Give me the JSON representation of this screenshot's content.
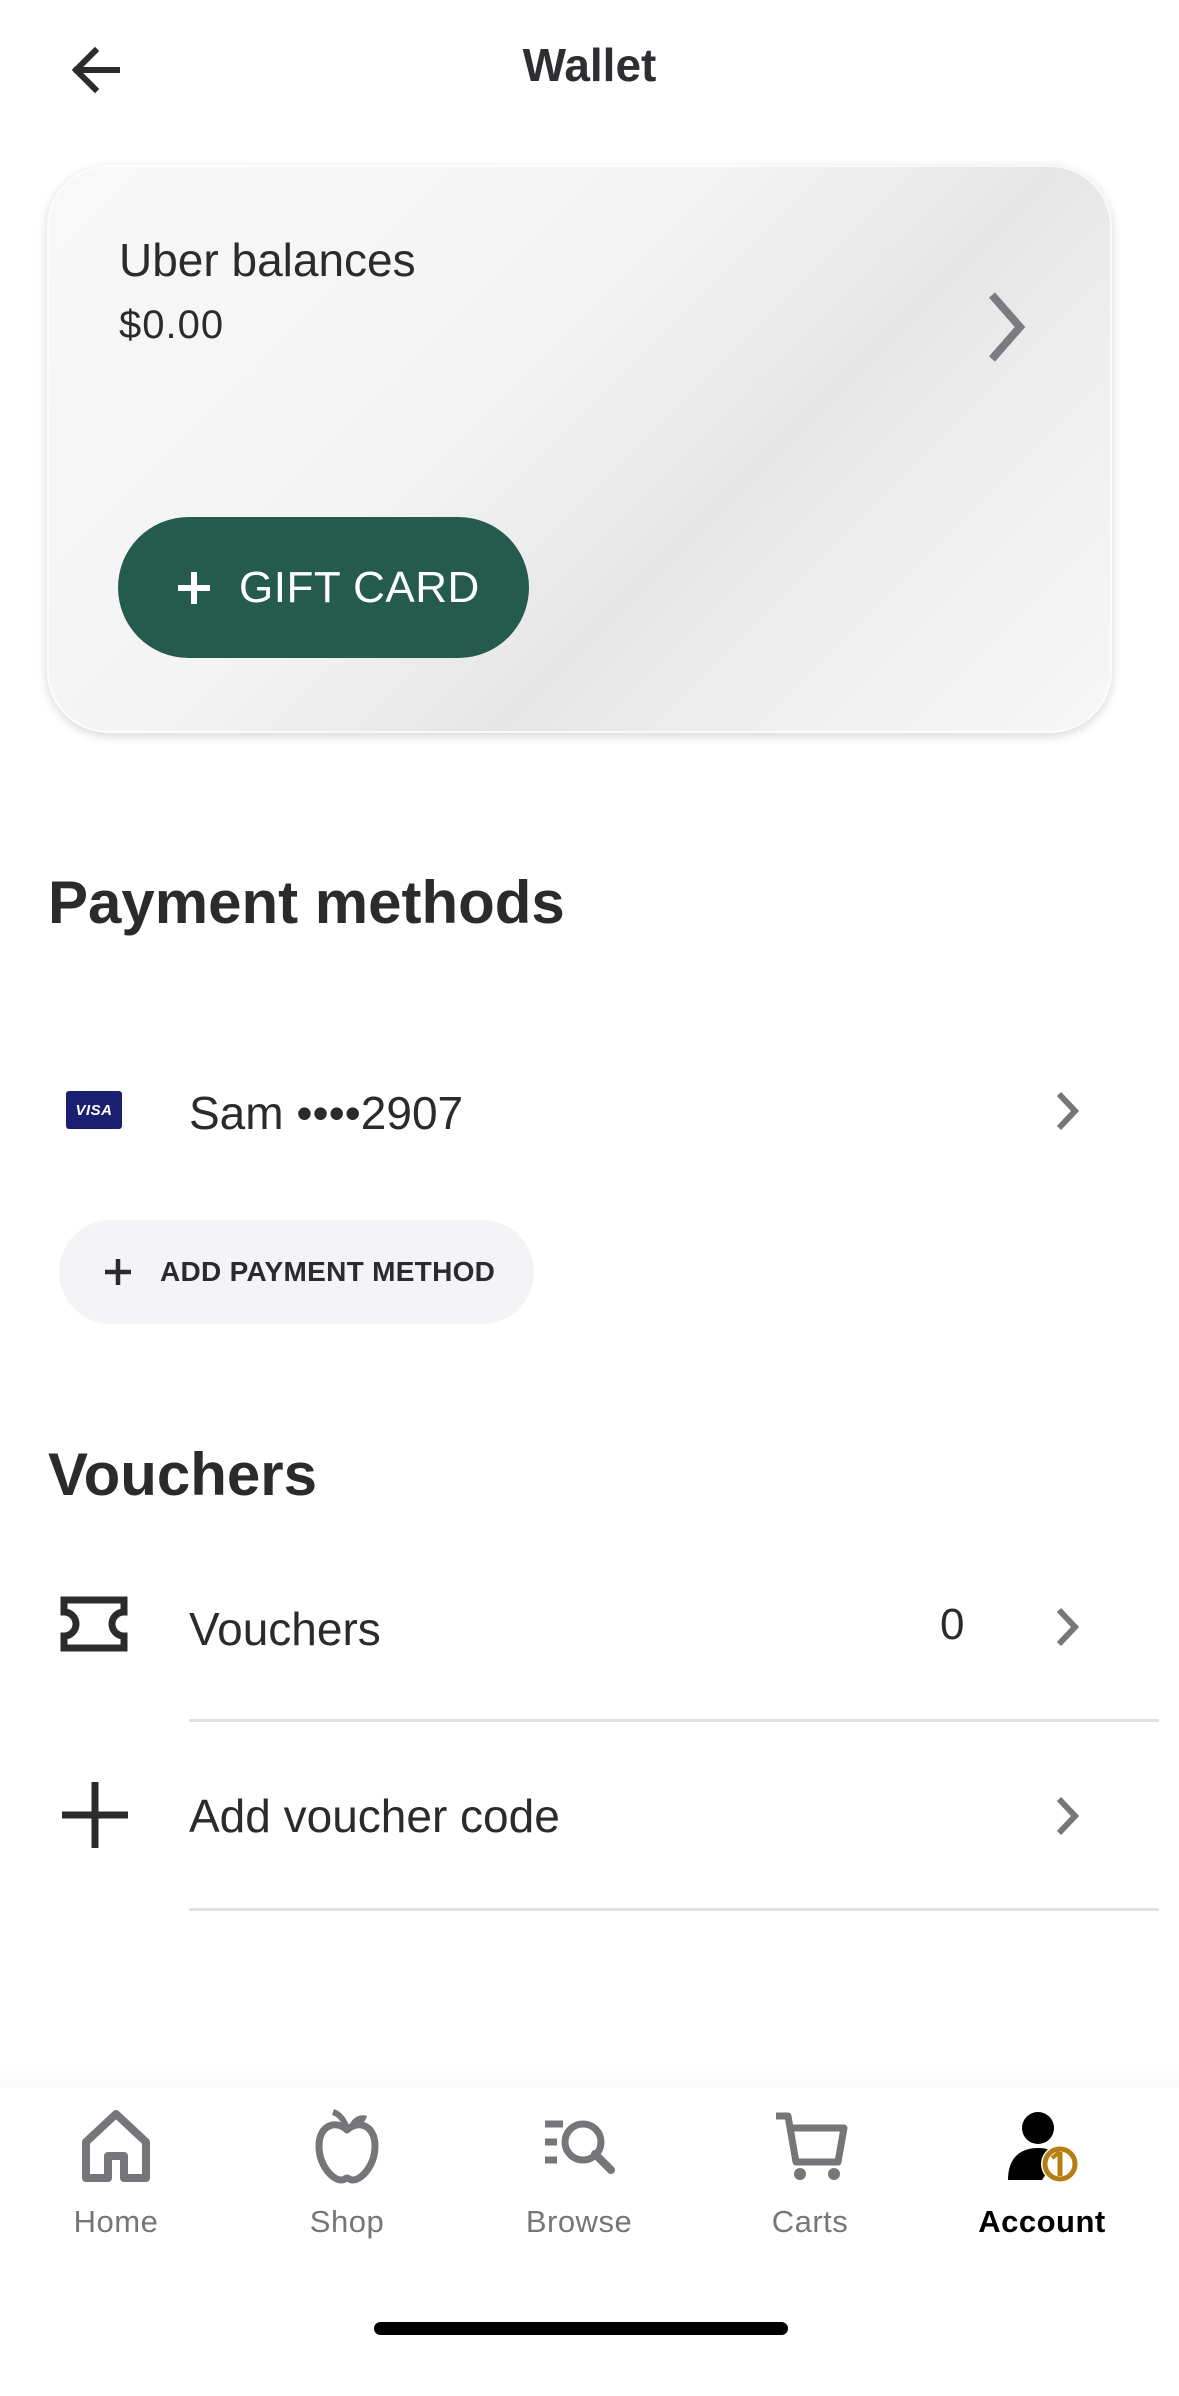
{
  "header": {
    "title": "Wallet"
  },
  "balance_card": {
    "title": "Uber balances",
    "amount": "$0.00",
    "gift_card_label": "GIFT CARD"
  },
  "payment": {
    "heading": "Payment methods",
    "card_brand": "VISA",
    "card_label": "Sam ••••2907",
    "add_label": "ADD PAYMENT METHOD"
  },
  "vouchers": {
    "heading": "Vouchers",
    "row_label": "Vouchers",
    "count": "0",
    "add_label": "Add voucher code"
  },
  "nav": {
    "items": [
      {
        "label": "Home",
        "icon": "home-icon"
      },
      {
        "label": "Shop",
        "icon": "apple-icon"
      },
      {
        "label": "Browse",
        "icon": "browse-search-icon"
      },
      {
        "label": "Carts",
        "icon": "cart-icon"
      },
      {
        "label": "Account",
        "icon": "account-icon",
        "active": true
      }
    ]
  },
  "colors": {
    "accent_green": "#255b4d",
    "visa_blue": "#1a1f71",
    "account_badge": "#b57d12"
  }
}
